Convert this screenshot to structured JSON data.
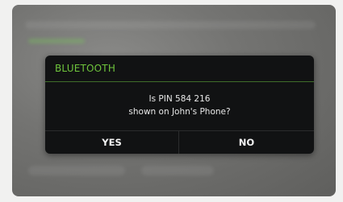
{
  "dialog": {
    "title": "BLUETOOTH",
    "message_line1": "Is PIN 584 216",
    "message_line2": "shown on John's Phone?",
    "yes_label": "YES",
    "no_label": "NO"
  },
  "colors": {
    "title": "#6fc53c",
    "dialog_bg": "#111213",
    "background": "#6e6e6c"
  }
}
